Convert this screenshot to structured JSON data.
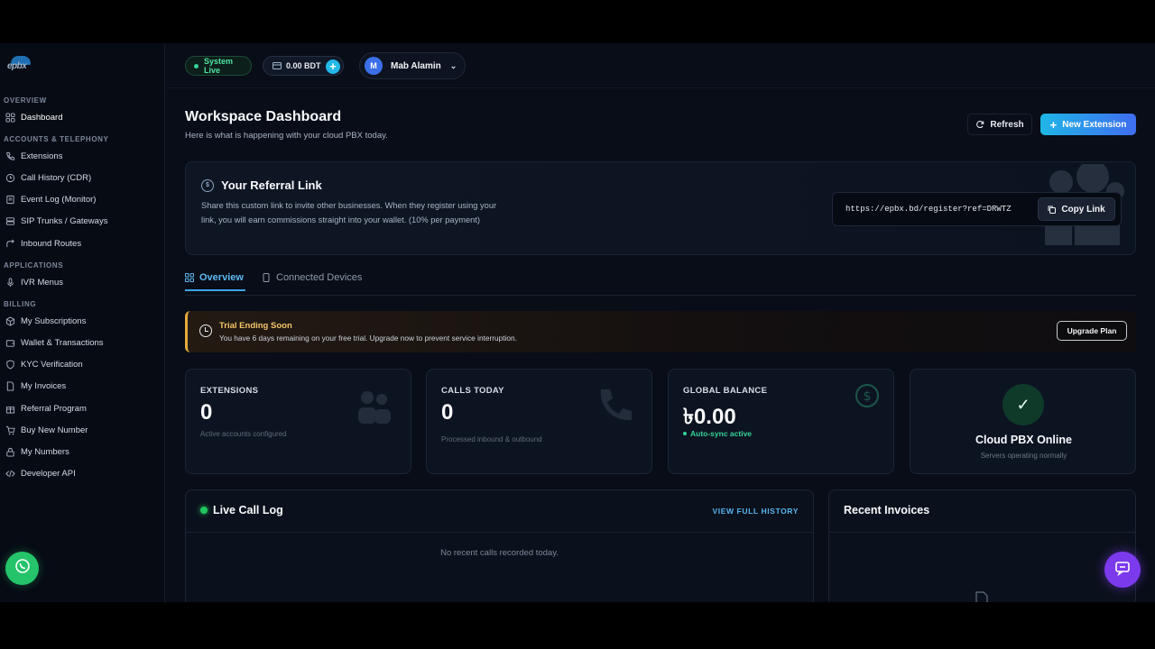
{
  "sidebar": {
    "logo_text": "epbx",
    "sections": {
      "overview": "OVERVIEW",
      "accounts": "ACCOUNTS & TELEPHONY",
      "applications": "APPLICATIONS",
      "billing": "BILLING"
    },
    "items": {
      "dashboard": "Dashboard",
      "extensions": "Extensions",
      "call_history": "Call History (CDR)",
      "event_log": "Event Log (Monitor)",
      "sip_trunks": "SIP Trunks / Gateways",
      "inbound_routes": "Inbound Routes",
      "ivr_menus": "IVR Menus",
      "subscriptions": "My Subscriptions",
      "wallet": "Wallet & Transactions",
      "kyc": "KYC Verification",
      "invoices": "My Invoices",
      "referral": "Referral Program",
      "buy_number": "Buy New Number",
      "my_numbers": "My Numbers",
      "developer_api": "Developer API"
    }
  },
  "header": {
    "status": "System Live",
    "balance": "0.00 BDT",
    "user_initial": "M",
    "user_name": "Mab Alamin"
  },
  "page": {
    "title": "Workspace Dashboard",
    "subtitle": "Here is what is happening with your cloud PBX today.",
    "refresh_label": "Refresh",
    "new_extension_label": "New Extension"
  },
  "referral": {
    "title": "Your Referral Link",
    "description": "Share this custom link to invite other businesses. When they register using your link, you will earn commissions straight into your wallet. (10% per payment)",
    "link": "https://epbx.bd/register?ref=DRWTZ",
    "copy_label": "Copy Link"
  },
  "tabs": {
    "overview": "Overview",
    "devices": "Connected Devices"
  },
  "trial": {
    "title": "Trial Ending Soon",
    "description": "You have 6 days remaining on your free trial. Upgrade now to prevent service interruption.",
    "upgrade_label": "Upgrade Plan"
  },
  "stats": {
    "extensions": {
      "label": "EXTENSIONS",
      "value": "0",
      "sub": "Active accounts configured"
    },
    "calls": {
      "label": "CALLS TODAY",
      "value": "0",
      "sub": "Processed inbound & outbound"
    },
    "balance": {
      "label": "GLOBAL BALANCE",
      "value": "৳0.00",
      "sync": "Auto-sync active"
    },
    "online": {
      "title": "Cloud PBX Online",
      "sub": "Servers operating normally"
    }
  },
  "panels": {
    "live_calls": {
      "title": "Live Call Log",
      "view_all": "VIEW FULL HISTORY",
      "empty": "No recent calls recorded today."
    },
    "invoices": {
      "title": "Recent Invoices"
    }
  },
  "colors": {
    "accent": "#3ba5e8",
    "success": "#34d399",
    "warning": "#e4a93a",
    "chat": "#7c3aed",
    "whatsapp": "#25c36a"
  }
}
